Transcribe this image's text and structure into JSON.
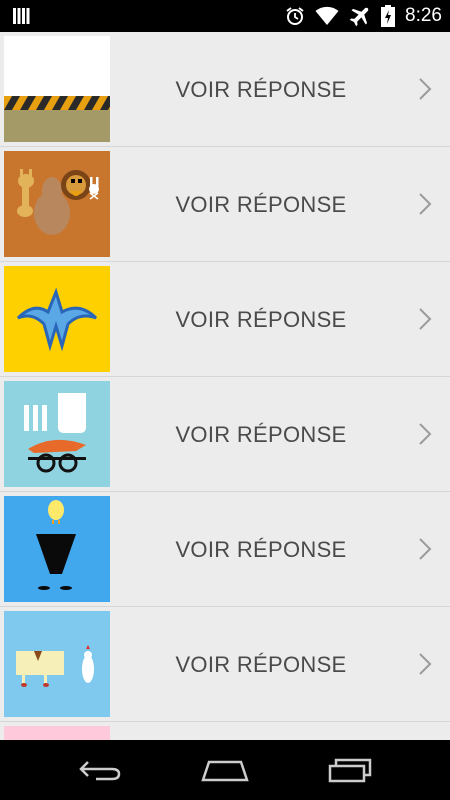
{
  "status_bar": {
    "time": "8:26",
    "icons": [
      "notification-icon",
      "alarm-icon",
      "wifi-icon",
      "airplane-mode-icon",
      "battery-charging-icon"
    ]
  },
  "list": {
    "items": [
      {
        "label": "VOIR RÉPONSE",
        "thumbnail": "construction-barrier-thumbnail",
        "bg": "#ffffff"
      },
      {
        "label": "VOIR RÉPONSE",
        "thumbnail": "animals-thumbnail",
        "bg": "#c8752e"
      },
      {
        "label": "VOIR RÉPONSE",
        "thumbnail": "superhero-logo-thumbnail",
        "bg": "#ffd000"
      },
      {
        "label": "VOIR RÉPONSE",
        "thumbnail": "scientist-thumbnail",
        "bg": "#8fd3e0"
      },
      {
        "label": "VOIR RÉPONSE",
        "thumbnail": "lamp-chick-thumbnail",
        "bg": "#42a8ee"
      },
      {
        "label": "VOIR RÉPONSE",
        "thumbnail": "sheet-chicken-thumbnail",
        "bg": "#7fc8ee"
      },
      {
        "label": "",
        "thumbnail": "pink-thumbnail",
        "bg": "#ffc9dc"
      }
    ]
  },
  "nav_bar": {
    "buttons": [
      "back-icon",
      "home-icon",
      "recent-apps-icon"
    ]
  }
}
